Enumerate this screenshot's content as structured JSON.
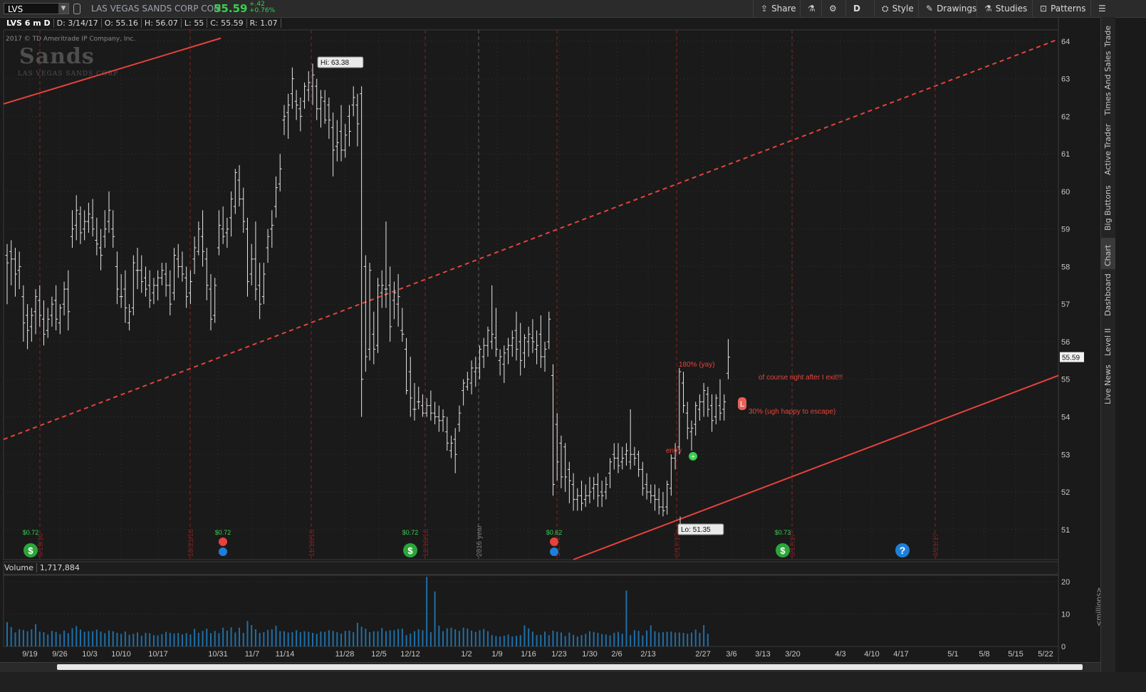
{
  "header": {
    "symbol": "LVS",
    "company": "LAS VEGAS SANDS CORP COM",
    "last_price": "55.59",
    "change": "+.42",
    "change_pct": "+0.76%",
    "buttons": [
      {
        "label": "Share",
        "icon": "share-icon"
      },
      {
        "label": "",
        "icon": "flask-icon"
      },
      {
        "label": "",
        "icon": "gear-icon"
      },
      {
        "label": "D",
        "icon": ""
      },
      {
        "label": "Style",
        "icon": "style-icon"
      },
      {
        "label": "Drawings",
        "icon": "pencil-icon"
      },
      {
        "label": "Studies",
        "icon": "flask-icon"
      },
      {
        "label": "Patterns",
        "icon": "patterns-icon"
      }
    ]
  },
  "infobar": {
    "label": "LVS 6 m D",
    "date": "D: 3/14/17",
    "open": "O: 55.16",
    "high": "H: 56.07",
    "low": "L: 55",
    "close": "C: 55.59",
    "range": "R: 1.07"
  },
  "watermark": {
    "copyright": "2017 © TD Ameritrade IP Company, Inc.",
    "logo": "Sands",
    "logo_sub": "LAS VEGAS SANDS CORP"
  },
  "volume_label": "Volume",
  "volume_value": "1,717,884",
  "volume_units": "<millions>",
  "right_panel": [
    "Trade",
    "Times And Sales",
    "Active Trader",
    "Big Buttons",
    "Chart",
    "Dashboard",
    "Level II",
    "Live News"
  ],
  "colors": {
    "background": "#1a1a1a",
    "bars": "#e6e6e6",
    "volume": "#1e6fa8",
    "trendline": "#e8423b",
    "up": "#37d04e",
    "grid": "#3a3a3a"
  },
  "chart_data": {
    "type": "ohlc",
    "title": "LVS 6 m D",
    "price_axis": {
      "ylim": [
        50.2,
        64.3
      ],
      "ticks": [
        51,
        52,
        53,
        54,
        55,
        56,
        57,
        58,
        59,
        60,
        61,
        62,
        63,
        64
      ]
    },
    "volume_axis": {
      "ylim": [
        0,
        22
      ],
      "ticks": [
        0,
        10,
        20
      ],
      "unit": "millions"
    },
    "x_labels": [
      "9/19",
      "9/26",
      "10/3",
      "10/10",
      "10/17",
      "10/31",
      "11/7",
      "11/14",
      "11/28",
      "12/5",
      "12/12",
      "1/2",
      "1/9",
      "1/16",
      "1/23",
      "1/30",
      "2/6",
      "2/13",
      "2/27",
      "3/6",
      "3/13",
      "3/20",
      "4/3",
      "4/10",
      "4/17",
      "5/1",
      "5/8",
      "5/15",
      "5/22"
    ],
    "bars": [
      [
        58.3,
        58.6,
        57.0,
        58.1
      ],
      [
        58.4,
        58.7,
        57.5,
        58.2
      ],
      [
        58.2,
        58.5,
        57.2,
        57.8
      ],
      [
        57.9,
        58.4,
        57.4,
        58.0
      ],
      [
        57.2,
        57.5,
        56.0,
        56.5
      ],
      [
        56.7,
        57.0,
        55.8,
        56.3
      ],
      [
        56.4,
        56.9,
        56.0,
        56.7
      ],
      [
        56.8,
        57.4,
        56.2,
        57.2
      ],
      [
        57.1,
        57.5,
        56.4,
        56.7
      ],
      [
        56.6,
        57.1,
        55.9,
        56.2
      ],
      [
        56.3,
        56.9,
        56.1,
        56.6
      ],
      [
        56.7,
        57.2,
        56.4,
        57.0
      ],
      [
        57.1,
        57.5,
        56.3,
        56.6
      ],
      [
        56.5,
        57.0,
        56.2,
        56.9
      ],
      [
        57.0,
        57.6,
        56.7,
        57.4
      ],
      [
        57.4,
        57.9,
        56.3,
        56.8
      ],
      [
        58.8,
        59.5,
        58.5,
        59.0
      ],
      [
        59.1,
        59.9,
        58.7,
        59.5
      ],
      [
        59.4,
        59.6,
        58.6,
        58.9
      ],
      [
        59.0,
        59.5,
        58.7,
        59.2
      ],
      [
        59.2,
        59.7,
        58.9,
        59.4
      ],
      [
        59.3,
        59.8,
        58.8,
        59.0
      ],
      [
        58.7,
        59.3,
        58.3,
        58.6
      ],
      [
        58.5,
        59.0,
        57.9,
        58.3
      ],
      [
        58.8,
        59.5,
        58.5,
        59.0
      ],
      [
        59.2,
        60.0,
        58.9,
        59.5
      ],
      [
        59.0,
        59.5,
        58.5,
        58.8
      ],
      [
        58.0,
        58.4,
        57.0,
        57.4
      ],
      [
        57.2,
        57.8,
        56.9,
        57.2
      ],
      [
        57.4,
        57.9,
        56.5,
        56.9
      ],
      [
        56.5,
        57.0,
        56.3,
        56.8
      ],
      [
        56.9,
        58.3,
        56.7,
        58.1
      ],
      [
        57.9,
        58.5,
        57.4,
        57.9
      ],
      [
        57.9,
        58.3,
        57.3,
        57.6
      ],
      [
        57.7,
        58.0,
        57.2,
        57.4
      ],
      [
        57.5,
        57.9,
        56.9,
        57.1
      ],
      [
        57.3,
        57.7,
        57.0,
        57.5
      ],
      [
        57.5,
        57.9,
        57.1,
        57.7
      ],
      [
        57.7,
        58.1,
        57.5,
        57.9
      ],
      [
        57.8,
        58.1,
        57.2,
        57.5
      ],
      [
        57.5,
        57.9,
        56.7,
        57.0
      ],
      [
        57.3,
        58.5,
        57.1,
        58.3
      ],
      [
        58.2,
        58.6,
        57.7,
        58.0
      ],
      [
        58.0,
        58.4,
        57.6,
        57.8
      ],
      [
        57.7,
        58.0,
        56.9,
        57.2
      ],
      [
        57.3,
        57.9,
        57.0,
        57.6
      ],
      [
        58.2,
        58.8,
        57.8,
        58.5
      ],
      [
        58.4,
        59.2,
        58.3,
        59.0
      ],
      [
        58.8,
        59.5,
        58.0,
        58.4
      ],
      [
        58.2,
        58.5,
        57.1,
        57.5
      ],
      [
        57.4,
        57.8,
        56.3,
        56.6
      ],
      [
        56.7,
        57.7,
        56.5,
        57.5
      ],
      [
        58.5,
        59.5,
        58.3,
        59.1
      ],
      [
        59.0,
        59.6,
        58.6,
        58.8
      ],
      [
        58.9,
        59.3,
        58.5,
        59.0
      ],
      [
        59.3,
        60.0,
        58.8,
        59.8
      ],
      [
        59.6,
        60.6,
        59.4,
        60.5
      ],
      [
        60.3,
        60.7,
        59.6,
        59.8
      ],
      [
        59.8,
        60.1,
        58.9,
        59.2
      ],
      [
        59.0,
        59.3,
        57.2,
        57.6
      ],
      [
        57.8,
        58.6,
        57.5,
        58.2
      ],
      [
        58.2,
        59.2,
        57.1,
        57.4
      ],
      [
        57.5,
        58.1,
        56.6,
        57.0
      ],
      [
        57.2,
        58.1,
        57.0,
        57.8
      ],
      [
        58.5,
        59.0,
        58.1,
        58.8
      ],
      [
        59.0,
        59.5,
        58.5,
        59.1
      ],
      [
        59.6,
        60.4,
        59.3,
        60.1
      ],
      [
        60.2,
        61.0,
        60.0,
        60.6
      ],
      [
        61.9,
        62.3,
        61.5,
        62.0
      ],
      [
        62.1,
        62.6,
        61.4,
        62.3
      ],
      [
        62.6,
        63.3,
        62.2,
        63.0
      ],
      [
        62.4,
        62.7,
        61.9,
        62.3
      ],
      [
        62.2,
        62.5,
        61.6,
        62.0
      ],
      [
        62.4,
        62.9,
        62.2,
        62.8
      ],
      [
        62.7,
        63.2,
        62.4,
        62.9
      ],
      [
        62.8,
        63.4,
        62.3,
        63.1
      ],
      [
        62.8,
        63.0,
        61.9,
        62.2
      ],
      [
        62.2,
        62.7,
        61.7,
        62.5
      ],
      [
        62.4,
        62.7,
        61.8,
        61.9
      ],
      [
        62.3,
        62.5,
        61.4,
        61.9
      ],
      [
        61.7,
        62.1,
        60.4,
        61.1
      ],
      [
        61.2,
        61.9,
        60.8,
        61.3
      ],
      [
        61.6,
        62.3,
        60.8,
        61.1
      ],
      [
        61.1,
        61.8,
        60.9,
        61.5
      ],
      [
        62.0,
        62.3,
        61.2,
        61.6
      ],
      [
        62.3,
        62.8,
        62.0,
        62.5
      ],
      [
        62.3,
        62.6,
        61.2,
        61.8
      ],
      [
        62.6,
        62.8,
        54.0,
        55.0
      ],
      [
        58.0,
        58.3,
        55.2,
        55.6
      ],
      [
        55.8,
        58.1,
        55.5,
        57.9
      ],
      [
        56.2,
        56.8,
        55.4,
        55.8
      ],
      [
        55.9,
        57.7,
        55.7,
        57.5
      ],
      [
        57.3,
        57.9,
        56.9,
        57.5
      ],
      [
        57.4,
        59.2,
        56.9,
        57.4
      ],
      [
        57.5,
        58.0,
        56.0,
        56.4
      ],
      [
        57.1,
        57.6,
        56.6,
        57.3
      ],
      [
        57.0,
        57.8,
        56.4,
        57.2
      ],
      [
        56.3,
        56.9,
        56.0,
        56.2
      ],
      [
        55.8,
        56.1,
        54.6,
        54.7
      ],
      [
        55.2,
        55.6,
        54.0,
        54.5
      ],
      [
        54.2,
        54.9,
        53.9,
        54.2
      ],
      [
        54.4,
        54.8,
        54.2,
        54.4
      ],
      [
        54.3,
        54.6,
        54.0,
        54.1
      ],
      [
        54.1,
        54.5,
        54.0,
        54.3
      ],
      [
        54.3,
        54.7,
        53.9,
        54.1
      ],
      [
        54.1,
        54.4,
        53.8,
        54.0
      ],
      [
        54.0,
        54.3,
        53.6,
        53.9
      ],
      [
        53.9,
        54.2,
        53.6,
        54.0
      ],
      [
        53.6,
        54.0,
        53.1,
        53.3
      ],
      [
        53.1,
        53.5,
        52.9,
        53.3
      ],
      [
        53.4,
        53.7,
        52.5,
        53.0
      ],
      [
        53.8,
        54.3,
        53.6,
        54.1
      ],
      [
        54.7,
        55.0,
        54.3,
        54.9
      ],
      [
        54.8,
        55.2,
        54.7,
        55.0
      ],
      [
        54.9,
        55.5,
        54.6,
        55.3
      ],
      [
        55.2,
        55.6,
        54.8,
        55.3
      ],
      [
        55.3,
        55.9,
        55.0,
        55.8
      ],
      [
        55.6,
        56.1,
        55.3,
        55.9
      ],
      [
        55.9,
        56.4,
        55.6,
        56.3
      ],
      [
        56.0,
        57.5,
        55.8,
        56.2
      ],
      [
        56.1,
        56.9,
        55.6,
        55.8
      ],
      [
        55.5,
        55.8,
        55.1,
        55.6
      ],
      [
        55.4,
        55.9,
        54.9,
        55.7
      ],
      [
        55.8,
        56.1,
        55.4,
        55.9
      ],
      [
        55.9,
        56.3,
        55.6,
        56.1
      ],
      [
        56.3,
        56.8,
        55.5,
        55.8
      ],
      [
        56.0,
        56.5,
        55.1,
        55.5
      ],
      [
        55.7,
        56.2,
        55.3,
        56.1
      ],
      [
        56.0,
        56.4,
        55.6,
        56.2
      ],
      [
        56.1,
        56.6,
        55.7,
        56.0
      ],
      [
        55.8,
        56.3,
        55.4,
        55.9
      ],
      [
        56.2,
        56.7,
        55.3,
        55.6
      ],
      [
        55.6,
        56.0,
        55.2,
        55.8
      ],
      [
        56.0,
        56.8,
        55.8,
        56.6
      ],
      [
        55.1,
        55.4,
        51.9,
        52.2
      ],
      [
        53.8,
        54.1,
        52.3,
        52.8
      ],
      [
        53.3,
        53.5,
        52.1,
        52.4
      ],
      [
        53.2,
        53.3,
        52.0,
        52.4
      ],
      [
        52.6,
        52.8,
        51.7,
        52.3
      ],
      [
        52.2,
        52.5,
        51.5,
        51.8
      ],
      [
        51.8,
        52.1,
        51.5,
        51.9
      ],
      [
        51.9,
        52.3,
        51.5,
        51.7
      ],
      [
        51.8,
        52.2,
        51.6,
        51.9
      ],
      [
        51.9,
        52.4,
        51.7,
        52.0
      ],
      [
        52.1,
        52.4,
        51.8,
        52.2
      ],
      [
        52.2,
        52.5,
        51.6,
        51.9
      ],
      [
        52.0,
        52.3,
        51.6,
        51.9
      ],
      [
        52.0,
        52.4,
        51.8,
        52.2
      ],
      [
        52.5,
        52.9,
        52.1,
        52.8
      ],
      [
        53.0,
        53.3,
        52.6,
        52.9
      ],
      [
        52.9,
        53.3,
        52.5,
        52.7
      ],
      [
        52.8,
        53.2,
        52.6,
        52.9
      ],
      [
        53.0,
        53.3,
        52.7,
        53.1
      ],
      [
        52.8,
        54.2,
        52.6,
        53.0
      ],
      [
        53.0,
        53.2,
        52.7,
        52.9
      ],
      [
        53.0,
        53.1,
        52.4,
        52.6
      ],
      [
        52.6,
        52.8,
        51.9,
        52.1
      ],
      [
        52.2,
        52.5,
        51.8,
        52.0
      ],
      [
        52.0,
        52.2,
        51.7,
        51.9
      ],
      [
        51.9,
        52.2,
        51.5,
        51.8
      ],
      [
        51.8,
        52.1,
        51.4,
        51.6
      ],
      [
        51.6,
        52.0,
        51.35,
        51.5
      ],
      [
        51.6,
        52.3,
        51.4,
        52.2
      ],
      [
        52.1,
        53.0,
        51.9,
        52.9
      ],
      [
        52.9,
        53.3,
        52.6,
        53.1
      ],
      [
        53.2,
        55.3,
        53.0,
        55.2
      ],
      [
        54.9,
        55.2,
        54.1,
        54.3
      ],
      [
        54.1,
        54.4,
        53.4,
        53.7
      ],
      [
        53.6,
        53.9,
        53.1,
        53.7
      ],
      [
        53.8,
        54.4,
        53.5,
        54.3
      ],
      [
        54.2,
        54.6,
        53.9,
        54.4
      ],
      [
        54.4,
        54.9,
        54.0,
        54.7
      ],
      [
        54.6,
        54.8,
        54.0,
        54.2
      ],
      [
        54.3,
        54.6,
        53.6,
        53.9
      ],
      [
        54.0,
        54.6,
        53.8,
        54.5
      ],
      [
        54.3,
        55.0,
        53.9,
        54.1
      ],
      [
        54.2,
        54.6,
        53.9,
        54.4
      ],
      [
        55.16,
        56.07,
        55.0,
        55.59
      ]
    ],
    "volume_millions": [
      7.5,
      6.0,
      4.3,
      5.3,
      5.1,
      4.7,
      5.3,
      6.9,
      4.6,
      4.4,
      3.7,
      4.8,
      4.5,
      3.8,
      4.9,
      4.1,
      5.6,
      6.3,
      5.2,
      4.5,
      4.7,
      4.7,
      5.2,
      4.6,
      4.1,
      4.9,
      4.7,
      4.2,
      3.9,
      4.6,
      3.6,
      3.9,
      4.3,
      3.3,
      4.2,
      4.1,
      3.5,
      3.4,
      3.8,
      4.5,
      4.2,
      4.0,
      4.2,
      3.7,
      4.1,
      3.7,
      5.4,
      4.2,
      4.8,
      5.5,
      4.1,
      4.8,
      4.1,
      5.8,
      4.9,
      5.9,
      4.3,
      5.8,
      4.2,
      7.9,
      6.6,
      5.3,
      4.2,
      4.4,
      5.1,
      5.3,
      6.4,
      4.7,
      4.7,
      4.3,
      4.4,
      5.0,
      4.4,
      4.7,
      4.5,
      4.2,
      3.9,
      4.6,
      4.5,
      5.0,
      4.8,
      4.4,
      4.0,
      4.8,
      4.9,
      4.4,
      7.3,
      6.1,
      5.5,
      4.4,
      4.7,
      4.7,
      5.7,
      4.7,
      5.0,
      5.0,
      5.4,
      5.5,
      3.5,
      4.0,
      4.7,
      5.3,
      5.0,
      6.6,
      4.4,
      5.6,
      6.4,
      4.7,
      5.6,
      5.8,
      5.3,
      4.8,
      5.8,
      5.5,
      4.9,
      4.5,
      5.0,
      5.4,
      4.7,
      3.5,
      3.2,
      3.1,
      3.3,
      3.7,
      3.1,
      3.3,
      3.5,
      6.5,
      5.6,
      4.6,
      3.5,
      3.6,
      4.6,
      3.5,
      4.9,
      4.5,
      4.3,
      3.2,
      4.3,
      3.6,
      3.1,
      3.5,
      3.9,
      4.7,
      4.5,
      4.2,
      3.8,
      3.7,
      3.4,
      4.2,
      4.5,
      3.9,
      3.9,
      3.5,
      5.0,
      4.8,
      3.4,
      4.9,
      6.5,
      4.7,
      4.3,
      4.4,
      4.5,
      4.6,
      4.3,
      4.3,
      4.2,
      3.9,
      4.3,
      5.2,
      4.2,
      6.6,
      3.9
    ],
    "volume_highlights": {
      "103": 21.5,
      "105": 17.0,
      "152": 17.3
    },
    "hi_label": "Hi: 63.38",
    "lo_label": "Lo: 51.35",
    "current_price_label": "55.59",
    "vertical_grid_date_labels": [
      "9/19/16",
      "10/21/16",
      "11/18/16",
      "12/16/16",
      "2016 year",
      "1/17/17",
      "2/17/17",
      "3/17/17",
      "4/21/17"
    ],
    "events": [
      {
        "label": "$0.72",
        "icon": "dividend-icon"
      },
      {
        "label": "$0.72",
        "icon": "earnings-icon"
      },
      {
        "label": "$0.72",
        "icon": "dividend-icon"
      },
      {
        "label": "$0.62",
        "icon": "earnings-icon"
      },
      {
        "label": "$0.73",
        "icon": "dividend-icon"
      },
      {
        "label": "?",
        "icon": "question-icon"
      }
    ],
    "annotations": [
      {
        "label": "180% (yay)",
        "color": "#e8423b"
      },
      {
        "label": "of course right after I exit!!!",
        "color": "#e8423b"
      },
      {
        "label": "30% (ugh happy to escape)",
        "color": "#e8423b"
      },
      {
        "label": "entry",
        "color": "#e8423b"
      },
      {
        "label": "L",
        "color": "#e8423b"
      }
    ]
  }
}
